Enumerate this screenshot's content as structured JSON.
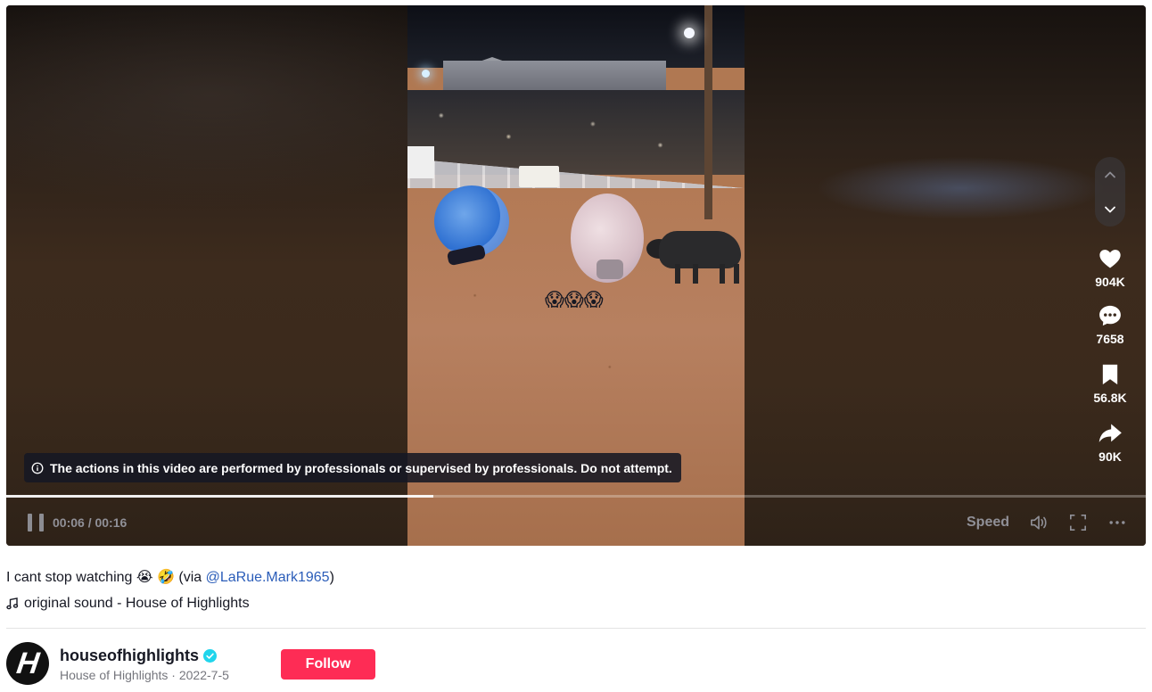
{
  "video": {
    "notice_text": "The actions in this video are performed by professionals or supervised by professionals. Do not attempt.",
    "overlay_emoji": "😱😱😱",
    "progress_fraction": 0.375,
    "time_readout": "00:06 / 00:16",
    "speed_label": "Speed",
    "icons": {
      "pause": "pause-icon",
      "volume": "volume-icon",
      "fullscreen": "fullscreen-icon",
      "more": "more-options-icon",
      "info": "info-icon"
    }
  },
  "actions": {
    "likes": "904K",
    "comments": "7658",
    "saves": "56.8K",
    "shares": "90K"
  },
  "description": {
    "text": "I cant stop watching 😭 🤣 (via ",
    "mention": "@LaRue.Mark1965",
    "text_end": ")"
  },
  "sound": {
    "label": "original sound - House of Highlights"
  },
  "author": {
    "username": "houseofhighlights",
    "display_name": "House of Highlights",
    "date": "2022-7-5",
    "separator": " · ",
    "avatar_letter": "H",
    "follow_label": "Follow"
  },
  "colors": {
    "accent": "#fe2c55",
    "mention": "#2b5db9",
    "verified": "#20d5ec"
  }
}
